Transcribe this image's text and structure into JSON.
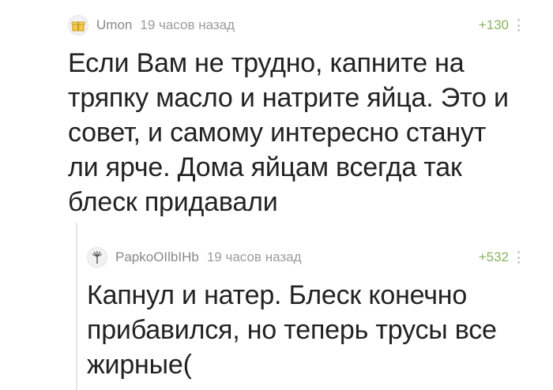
{
  "comments": [
    {
      "username": "Umon",
      "time": "19 часов назад",
      "rating": "+130",
      "avatar_icon": "gift-box-icon",
      "lines": [
        "Если Вам не трудно, капните на",
        "тряпку масло и натрите яйца. Это и",
        "совет, и самому интересно станут",
        "ли ярче. Дома яйцам всегда так",
        "блеск придавали"
      ]
    },
    {
      "username": "PapkoOIlbIHb",
      "time": "19 часов назад",
      "rating": "+532",
      "avatar_icon": "palm-tree-icon",
      "lines": [
        "Капнул и натер. Блеск конечно",
        "прибавился, но теперь трусы все",
        "жирные("
      ]
    }
  ],
  "colors": {
    "rating": "#8ab35e",
    "meta": "#888888",
    "text": "#222222"
  }
}
